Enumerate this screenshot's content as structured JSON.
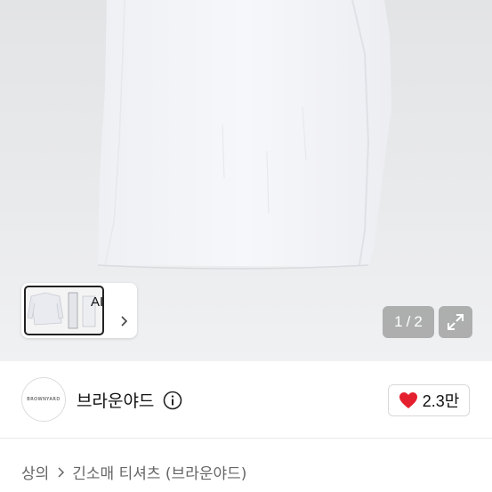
{
  "gallery": {
    "ai_label": "AI",
    "pager": {
      "current": "1",
      "separator": "/",
      "total": "2"
    }
  },
  "seller": {
    "avatar_text": "BROWNYARD",
    "name": "브라운야드",
    "likes": "2.3만"
  },
  "breadcrumb": {
    "items": [
      "상의",
      "긴소매 티셔츠 (브라운야드)"
    ]
  },
  "colors": {
    "heart": "#e5202e",
    "pager_bg": "#8c8c8c"
  },
  "icons": {
    "expand": "expand-icon",
    "info": "info-icon",
    "heart": "heart-icon",
    "chevron": "chevron-right-icon"
  }
}
